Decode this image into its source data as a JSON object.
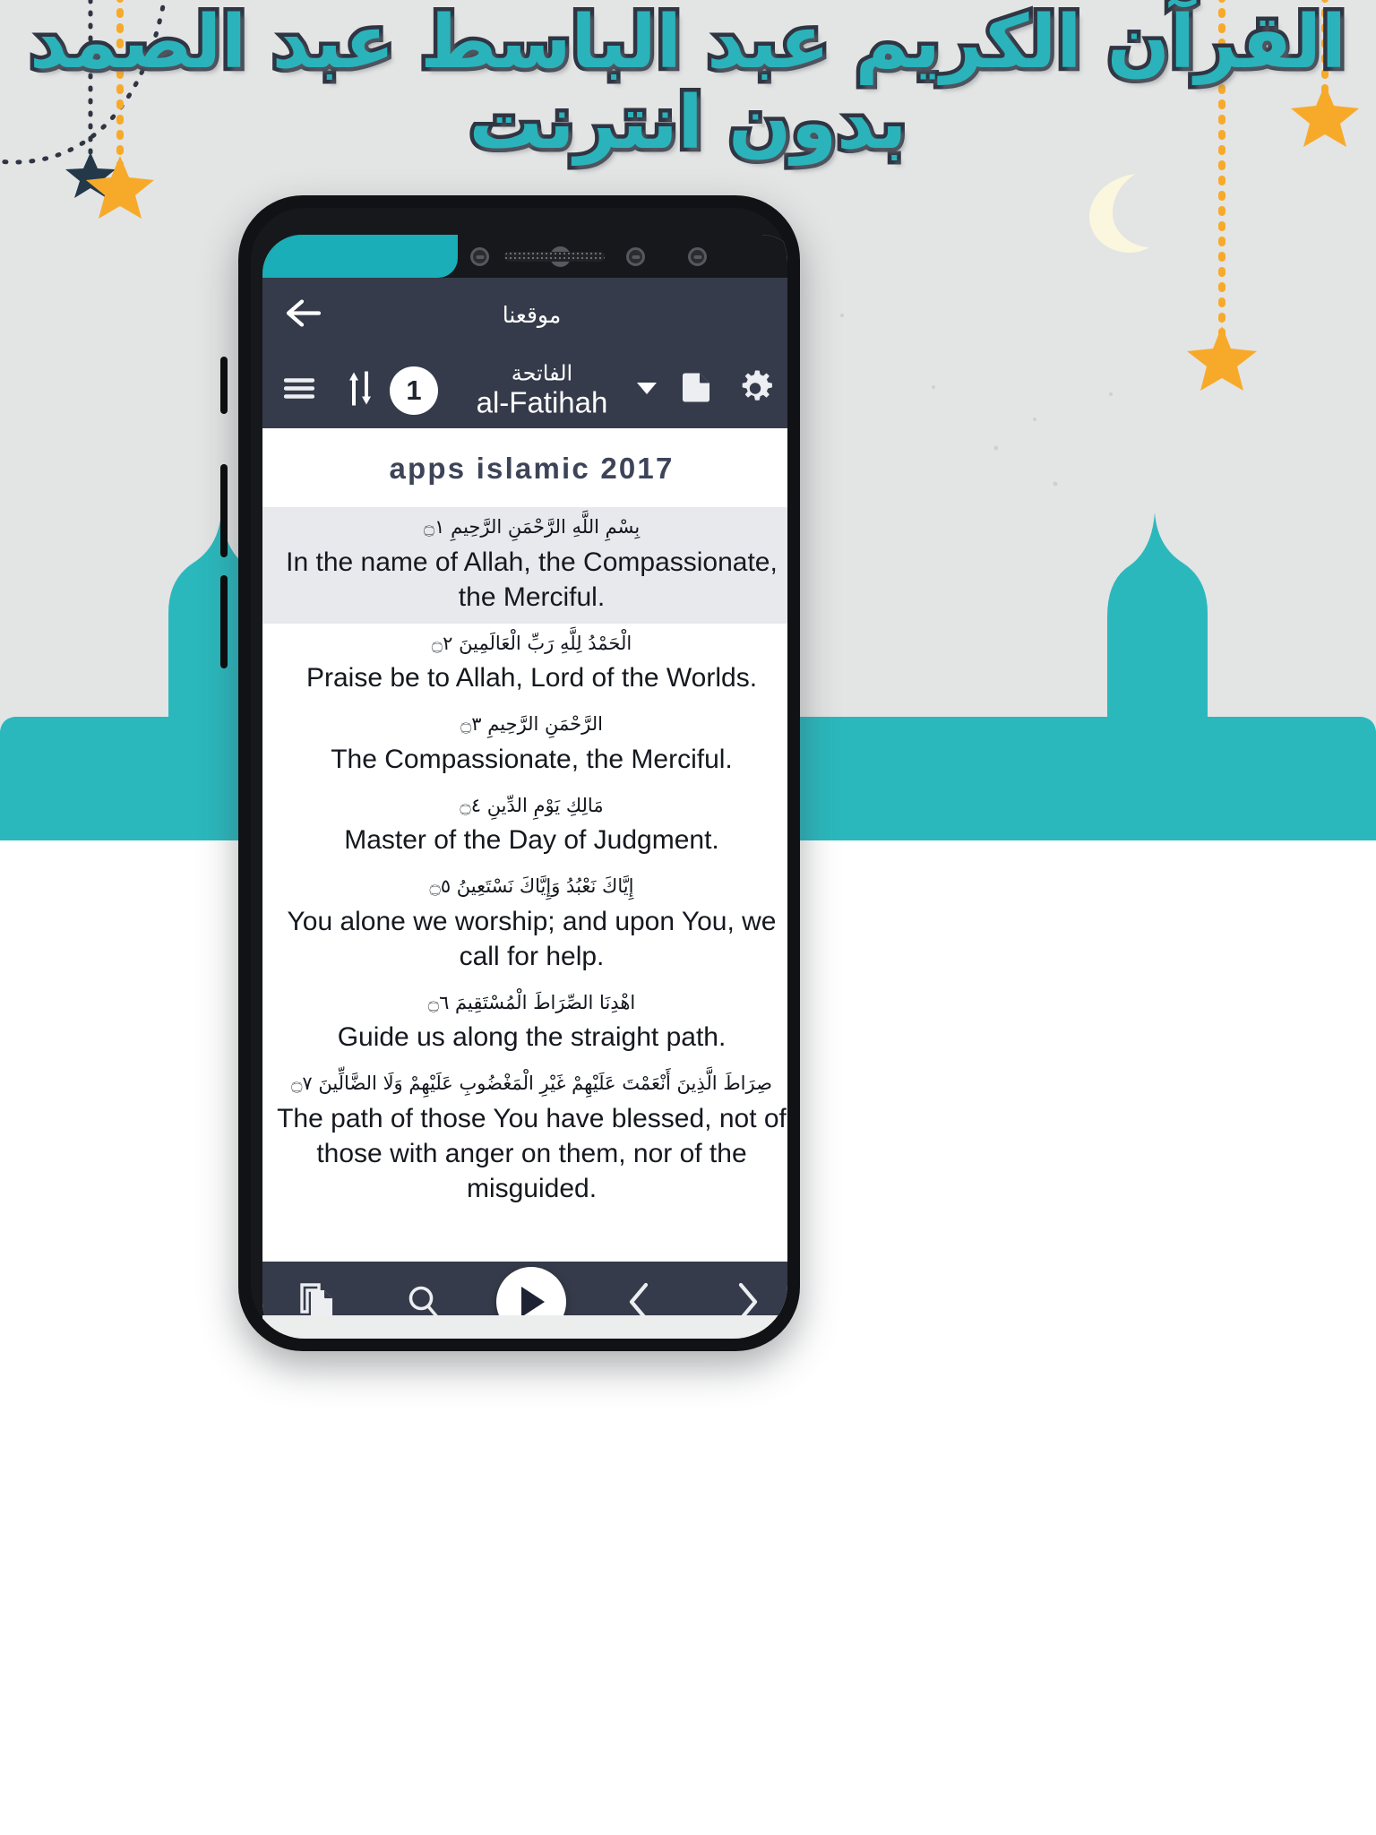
{
  "poster": {
    "headline_line1": "القرآن الكريم عبد الباسط عبد الصمد",
    "headline_line2": "بدون انترنت",
    "accent_teal": "#2bb3bb",
    "accent_dark": "#2f3542",
    "star_orange": "#f7aa2a",
    "star_dark": "#23394a",
    "background": "#e3e4e4",
    "mosque_teal": "#2bb8bd"
  },
  "app": {
    "status_bar": {
      "sensor_left_icon": "proximity-sensor-icon",
      "camera_icon": "front-camera-icon",
      "speaker_icon": "earpiece-speaker-icon",
      "sensor_right_icon": "light-sensor-icon"
    },
    "app_bar": {
      "back_icon": "back-arrow-icon",
      "title": "موقعنا"
    },
    "toolbar": {
      "menu_icon": "hamburger-menu-icon",
      "sort_icon": "sort-up-down-icon",
      "surah_number": "1",
      "surah_name_ar": "الفاتحة",
      "surah_name_en": "al-Fatihah",
      "dropdown_icon": "chevron-down-icon",
      "page_icon": "page-bookmark-icon",
      "settings_icon": "gear-icon"
    },
    "content": {
      "title": "apps islamic 2017",
      "verses": [
        {
          "number": "١",
          "arabic": "بِسْمِ اللَّهِ الرَّحْمَنِ الرَّحِيمِ",
          "english": "In the name of Allah, the Compassionate, the Merciful.",
          "highlighted": true
        },
        {
          "number": "٢",
          "arabic": "الْحَمْدُ لِلَّهِ رَبِّ الْعَالَمِينَ",
          "english": "Praise be to Allah, Lord of the Worlds.",
          "highlighted": false
        },
        {
          "number": "٣",
          "arabic": "الرَّحْمَنِ الرَّحِيمِ",
          "english": "The Compassionate, the Merciful.",
          "highlighted": false
        },
        {
          "number": "٤",
          "arabic": "مَالِكِ يَوْمِ الدِّينِ",
          "english": "Master of the Day of Judgment.",
          "highlighted": false
        },
        {
          "number": "٥",
          "arabic": "إِيَّاكَ نَعْبُدُ وَإِيَّاكَ نَسْتَعِينُ",
          "english": "You alone we worship; and upon You, we call for help.",
          "highlighted": false
        },
        {
          "number": "٦",
          "arabic": "اهْدِنَا الصِّرَاطَ الْمُسْتَقِيمَ",
          "english": "Guide us along the straight path.",
          "highlighted": false
        },
        {
          "number": "٧",
          "arabic": "صِرَاطَ الَّذِينَ أَنْعَمْتَ عَلَيْهِمْ غَيْرِ الْمَغْضُوبِ عَلَيْهِمْ وَلَا الضَّالِّينَ",
          "english": "The path of those You have blessed, not of those with anger on them, nor of the misguided.",
          "highlighted": false
        }
      ]
    },
    "bottom_nav": {
      "copy_icon": "copy-pages-icon",
      "search_icon": "search-icon",
      "play_icon": "play-icon",
      "previous_icon": "chevron-left-icon",
      "next_icon": "chevron-right-icon"
    }
  }
}
